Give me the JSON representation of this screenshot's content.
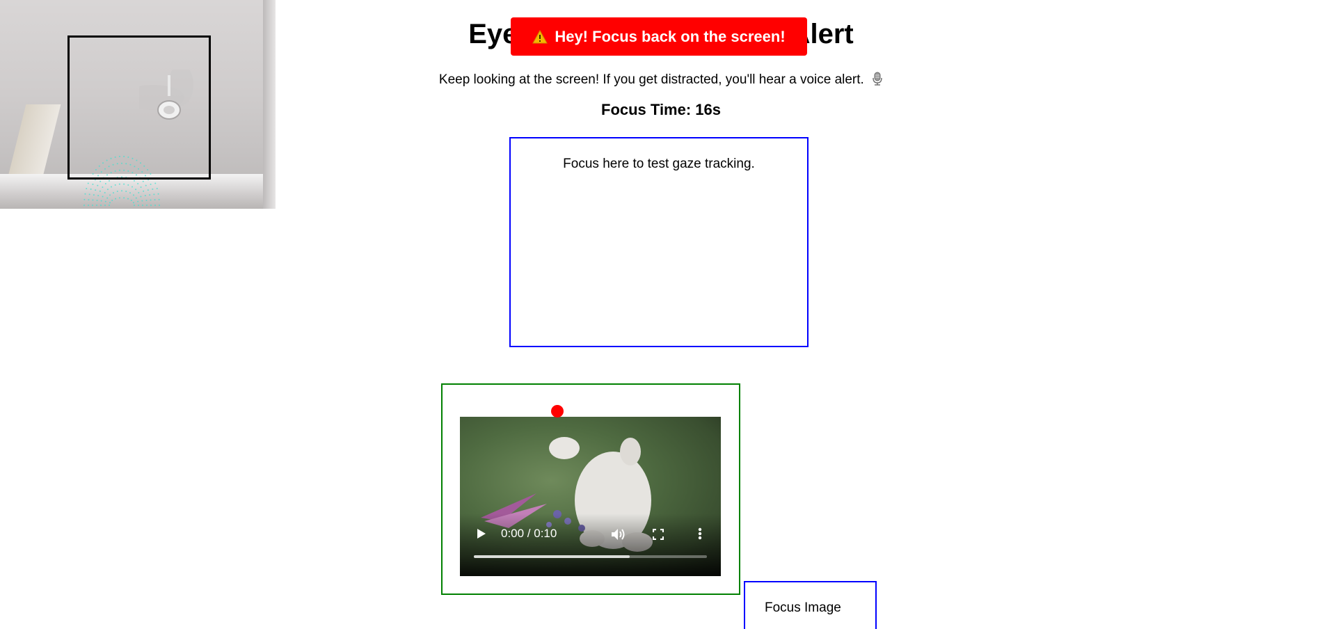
{
  "page": {
    "title": "Eye Tracking with Voice Alert",
    "subtitle": "Keep looking at the screen! If you get distracted, you'll hear a voice alert.",
    "subtitle_icon": "microphone-icon",
    "focus_time": "Focus Time: 16s"
  },
  "alert": {
    "icon": "warning-icon",
    "text": "Hey! Focus back on the screen!",
    "color": "#ff0000"
  },
  "gaze_box": {
    "label": "Focus here to test gaze tracking.",
    "border_color": "#0000ff"
  },
  "video": {
    "border_color": "#008000",
    "time": "0:00 / 0:10",
    "buffered_fraction": 0.67,
    "controls": [
      "play-icon",
      "volume-icon",
      "fullscreen-icon",
      "more-options-icon"
    ]
  },
  "gaze_marker_color": "#ff0000",
  "image_box": {
    "alt_text": "Focus Image",
    "border_color": "#0000ff"
  },
  "webcam": {
    "face_box_color": "#000000",
    "mesh_color": "#40e0d0"
  }
}
